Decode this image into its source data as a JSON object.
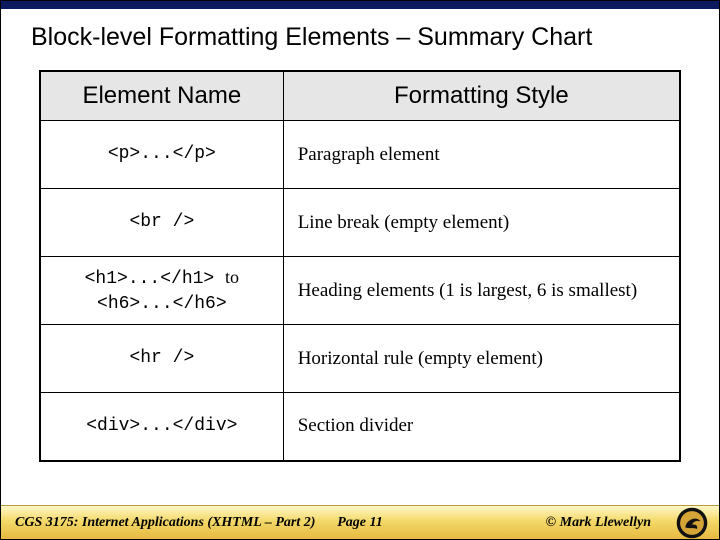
{
  "title": "Block-level Formatting Elements – Summary Chart",
  "table": {
    "headers": [
      "Element Name",
      "Formatting Style"
    ],
    "rows": [
      {
        "element_html": "<p>...</p>",
        "description": "Paragraph element"
      },
      {
        "element_html": "<br />",
        "description": "Line break (empty element)"
      },
      {
        "element_line1": "<h1>...</h1>",
        "to_word": "to",
        "element_line2": "<h6>...</h6>",
        "description": "Heading elements (1 is largest, 6 is smallest)"
      },
      {
        "element_html": "<hr />",
        "description": "Horizontal rule (empty element)"
      },
      {
        "element_html": "<div>...</div>",
        "description": "Section divider"
      }
    ]
  },
  "footer": {
    "course": "CGS 3175: Internet Applications (XHTML – Part 2)",
    "page": "Page 11",
    "copyright": "© Mark Llewellyn"
  },
  "chart_data": {
    "type": "table",
    "title": "Block-level Formatting Elements – Summary Chart",
    "columns": [
      "Element Name",
      "Formatting Style"
    ],
    "rows": [
      [
        "<p>...</p>",
        "Paragraph element"
      ],
      [
        "<br />",
        "Line break (empty element)"
      ],
      [
        "<h1>...</h1> to <h6>...</h6>",
        "Heading elements (1 is largest, 6 is smallest)"
      ],
      [
        "<hr />",
        "Horizontal rule (empty element)"
      ],
      [
        "<div>...</div>",
        "Section divider"
      ]
    ]
  }
}
